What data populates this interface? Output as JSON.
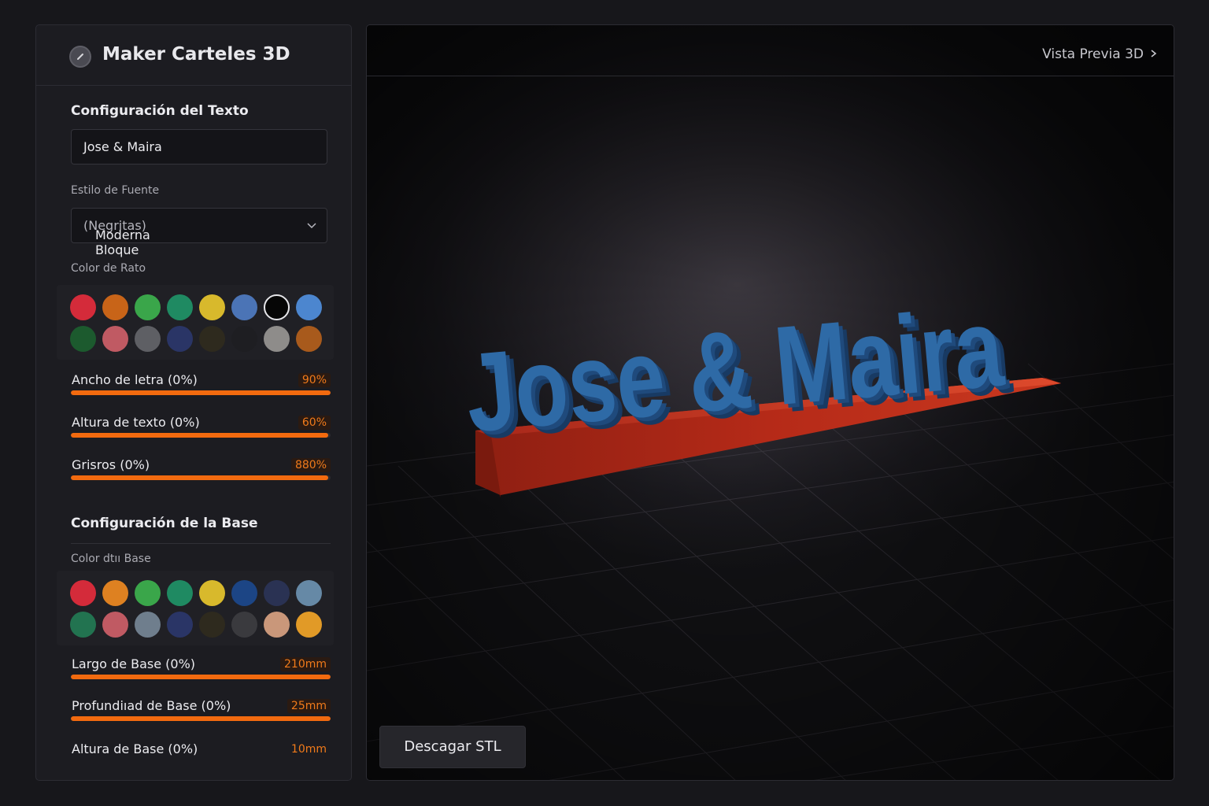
{
  "app": {
    "title": "Maker Carteles 3D"
  },
  "text_config": {
    "title": "Configuración del Texto",
    "text_value": "Jose & Maira",
    "font_label": "Estilo de Fuente",
    "font_selected": "Moderna Bloque",
    "font_selected_suffix": "(Negritas)",
    "color_label": "Color de Rato",
    "colors": [
      "#d42b3a",
      "#c86418",
      "#3aa64a",
      "#1f8a62",
      "#d8b92c",
      "#4b74b6",
      "#060606",
      "#4c86cf",
      "#1c5a2e",
      "#c05a63",
      "#5e5f64",
      "#2a3566",
      "#2e2a1e",
      "#1e1e22",
      "#8e8c8a",
      "#a85a1c"
    ],
    "sliders": [
      {
        "label": "Ancho de letra (0%)",
        "value": "90%",
        "fraction": 1.0
      },
      {
        "label": "Altura de texto (0%)",
        "value": "60%",
        "fraction": 0.99
      },
      {
        "label": "Grisros (0%)",
        "value": "880%",
        "fraction": 0.99
      }
    ]
  },
  "base_config": {
    "title": "Configuración de la Base",
    "color_label": "Color dtıı Base",
    "colors": [
      "#d42b3a",
      "#de8121",
      "#3aa64a",
      "#1f8a62",
      "#d8b92c",
      "#1c4585",
      "#2a3253",
      "#6689a6",
      "#227350",
      "#c05a63",
      "#6f7e8d",
      "#2a3566",
      "#2e2a1e",
      "#3a3a3e",
      "#c9977a",
      "#e19a27"
    ],
    "sliders": [
      {
        "label": "Largo de Base (0%)",
        "value": "210mm",
        "fraction": 1.0
      },
      {
        "label": "Profundiıad de Base (0%)",
        "value": "25mm",
        "fraction": 1.0
      },
      {
        "label": "Altura de Base (0%)",
        "value": "10mm"
      }
    ]
  },
  "preview": {
    "title": "Vista Previa 3D",
    "sign_text": "Jose & Maira",
    "text_color": "#2e6aa6",
    "base_color": "#c5301c",
    "download_label": "Descagar STL"
  }
}
